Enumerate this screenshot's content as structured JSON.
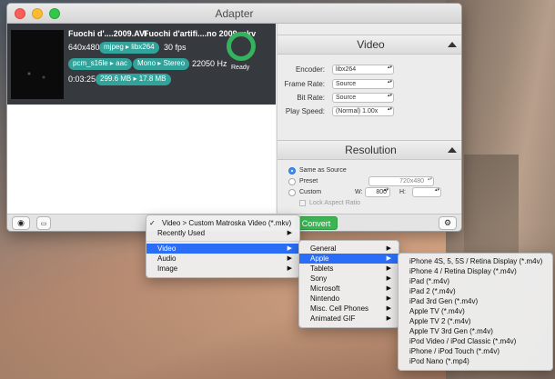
{
  "window": {
    "title": "Adapter"
  },
  "file": {
    "source_name": "Fuochi d'....2009.AVI",
    "output_name": "Fuochi d'artifi....no 2009.mkv",
    "resolution": "640x480",
    "video_codec_from": "mjpeg",
    "video_codec_to": "libx264",
    "fps": "30 fps",
    "audio_codec_from": "pcm_s16le",
    "audio_codec_to": "aac",
    "channels_from": "Mono",
    "channels_to": "Stereo",
    "sample_rate": "22050 Hz",
    "duration": "0:03:25",
    "size_from": "299.6 MB",
    "size_to": "17.8 MB",
    "status": "Ready"
  },
  "settings": {
    "video_header": "Video",
    "encoder_label": "Encoder:",
    "encoder_value": "libx264",
    "frame_rate_label": "Frame Rate:",
    "frame_rate_value": "Source",
    "bit_rate_label": "Bit Rate:",
    "bit_rate_value": "Source",
    "play_speed_label": "Play Speed:",
    "play_speed_value": "(Normal) 1.00x",
    "resolution_header": "Resolution",
    "same_as_source": "Same as Source",
    "preset": "Preset",
    "preset_value": "720x480",
    "custom": "Custom",
    "w_label": "W:",
    "w_value": "800",
    "h_label": "H:",
    "lock_aspect": "Lock Aspect Ratio"
  },
  "toolbar": {
    "convert_label": "Convert",
    "preview_icon": "eye-icon",
    "console_icon": "terminal-icon",
    "settings_icon": "gear-icon"
  },
  "menu_main": {
    "checked_item": "Video > Custom Matroska Video (*.mkv)",
    "recently_used": "Recently Used",
    "video": "Video",
    "audio": "Audio",
    "image": "Image"
  },
  "menu_video": [
    "General",
    "Apple",
    "Tablets",
    "Sony",
    "Microsoft",
    "Nintendo",
    "Misc. Cell Phones",
    "Animated GIF"
  ],
  "menu_apple": [
    "iPhone 4S, 5, 5S / Retina Display (*.m4v)",
    "iPhone 4 / Retina Display (*.m4v)",
    "iPad (*.m4v)",
    "iPad 2 (*.m4v)",
    "iPad 3rd Gen (*.m4v)",
    "Apple TV (*.m4v)",
    "Apple TV 2 (*.m4v)",
    "Apple TV 3rd Gen (*.m4v)",
    "iPod Video / iPod Classic (*.m4v)",
    "iPhone / iPod Touch (*.m4v)",
    "iPod Nano (*.mp4)"
  ],
  "colors": {
    "accent_teal": "#32a39a",
    "ready_green": "#35b25e",
    "convert_green": "#3bb552",
    "menu_highlight": "#2a6df6"
  }
}
